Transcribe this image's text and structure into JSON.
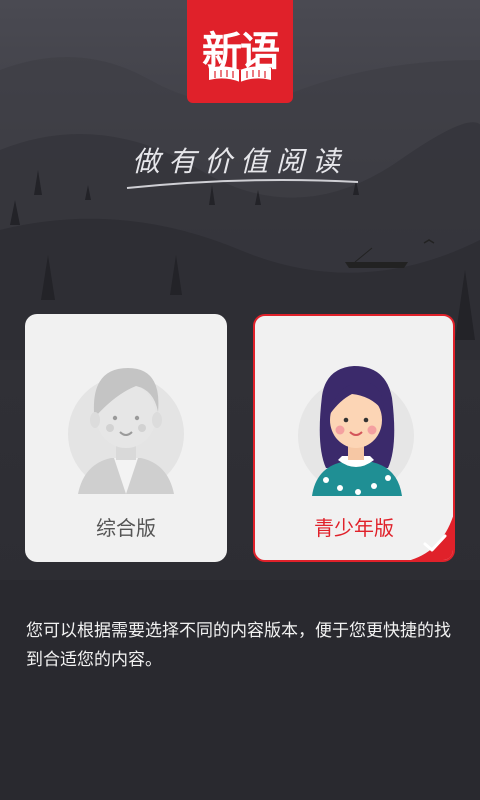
{
  "app": {
    "logo_text": "新语",
    "slogan": "做有价值阅读"
  },
  "cards": [
    {
      "label": "综合版",
      "selected": false
    },
    {
      "label": "青少年版",
      "selected": true
    }
  ],
  "description": "您可以根据需要选择不同的内容版本，便于您更快捷的找到合适您的内容。",
  "colors": {
    "accent": "#e0212a",
    "background": "#2a2a30",
    "card": "#f1f1f1"
  }
}
